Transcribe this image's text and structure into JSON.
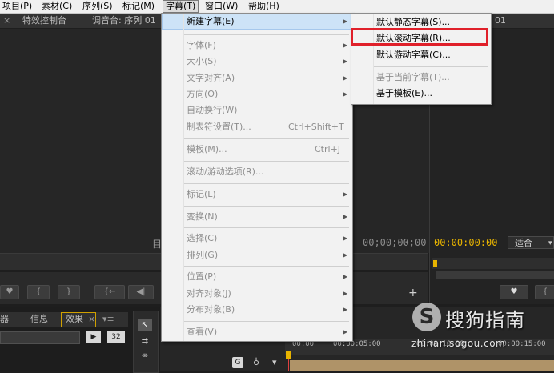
{
  "menubar": {
    "items": [
      {
        "label": "项目(P)"
      },
      {
        "label": "素材(C)"
      },
      {
        "label": "序列(S)"
      },
      {
        "label": "标记(M)"
      },
      {
        "label": "字幕(T)"
      },
      {
        "label": "窗口(W)"
      },
      {
        "label": "帮助(H)"
      }
    ]
  },
  "top_tabs": {
    "effect_controls": "特效控制台",
    "mixer": "调音台: 序列 01",
    "right_tab_suffix": "01"
  },
  "source_monitor": {
    "timecode": "00;00;00;00",
    "left_glyph": "目"
  },
  "program_monitor": {
    "timecode": "00:00:00:00",
    "zoom": "适合"
  },
  "project_panel": {
    "tabs": [
      "器",
      "信息",
      "效果"
    ],
    "icons": [
      "32"
    ]
  },
  "timeline": {
    "times": [
      "00:00",
      "00:00:05:00",
      "00:00:10:00",
      "00:00:15:00"
    ]
  },
  "title_menu": {
    "items": [
      {
        "label": "新建字幕(E)",
        "shortcut": "",
        "submenu": true,
        "disabled": false
      },
      {
        "label": "字体(F)",
        "shortcut": "",
        "submenu": true,
        "disabled": true
      },
      {
        "label": "大小(S)",
        "shortcut": "",
        "submenu": true,
        "disabled": true
      },
      {
        "label": "文字对齐(A)",
        "shortcut": "",
        "submenu": true,
        "disabled": true
      },
      {
        "label": "方向(O)",
        "shortcut": "",
        "submenu": true,
        "disabled": true
      },
      {
        "label": "自动换行(W)",
        "shortcut": "",
        "submenu": false,
        "disabled": true
      },
      {
        "label": "制表符设置(T)...",
        "shortcut": "Ctrl+Shift+T",
        "submenu": false,
        "disabled": true
      },
      {
        "label": "模板(M)...",
        "shortcut": "Ctrl+J",
        "submenu": false,
        "disabled": true
      },
      {
        "label": "滚动/游动选项(R)...",
        "shortcut": "",
        "submenu": false,
        "disabled": true
      },
      {
        "label": "标记(L)",
        "shortcut": "",
        "submenu": true,
        "disabled": true
      },
      {
        "label": "变换(N)",
        "shortcut": "",
        "submenu": true,
        "disabled": true
      },
      {
        "label": "选择(C)",
        "shortcut": "",
        "submenu": true,
        "disabled": true
      },
      {
        "label": "排列(G)",
        "shortcut": "",
        "submenu": true,
        "disabled": true
      },
      {
        "label": "位置(P)",
        "shortcut": "",
        "submenu": true,
        "disabled": true
      },
      {
        "label": "对齐对象(J)",
        "shortcut": "",
        "submenu": true,
        "disabled": true
      },
      {
        "label": "分布对象(B)",
        "shortcut": "",
        "submenu": true,
        "disabled": true
      },
      {
        "label": "查看(V)",
        "shortcut": "",
        "submenu": true,
        "disabled": true
      }
    ]
  },
  "new_title_submenu": {
    "items": [
      {
        "label": "默认静态字幕(S)...",
        "disabled": false,
        "highlighted": false
      },
      {
        "label": "默认滚动字幕(R)...",
        "disabled": false,
        "highlighted": true
      },
      {
        "label": "默认游动字幕(C)...",
        "disabled": false,
        "highlighted": false
      },
      {
        "label": "基于当前字幕(T)...",
        "disabled": true,
        "highlighted": false
      },
      {
        "label": "基于模板(E)...",
        "disabled": false,
        "highlighted": false
      }
    ]
  },
  "watermark": {
    "brand": "搜狗指南",
    "url": "zhinan.sogou.com"
  },
  "colors": {
    "highlight_box": "#e0202a",
    "timecode_yellow": "#e8b400",
    "menu_hover": "#cde3f7"
  }
}
